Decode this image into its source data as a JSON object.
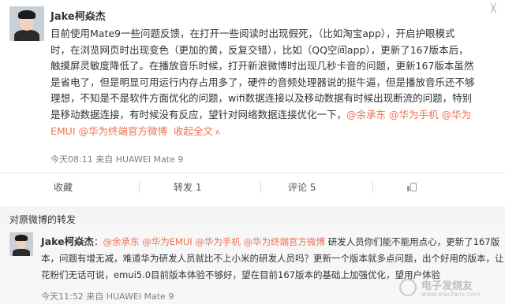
{
  "post": {
    "username": "Jake柯焱杰",
    "close_glyph": "╳",
    "lines": [
      "目前使用Mate9一些问题反馈，在打开一些阅读时出现假死，（比如淘宝app），开启护眼模式",
      "时，在浏览网页时出现变色（更加的黄，反复交错），比如（QQ空间app），更新了167版本后，",
      "触摸屏灵敏度降低了。在播放音乐时候，打开新浪微博时出现几秒卡音的问题，更新167版本虽然",
      "是省电了，但是明显可用运行内存占用多了，硬件的音频处理器说的挺牛逼，但是播放音乐还不够",
      "理想，不知是不是软件方面优化的问题，wifi数据连接以及移动数据有时候出现断流的问题，特别",
      "是移动数据连接，有时候没有反应，望针对网络数据连接优化一下，"
    ],
    "mentions_line6": "@余承东 @华为手机 @华为",
    "mentions_line7": "EMUI @华为终端官方微博",
    "expand_label": "收起全文",
    "expand_arrow": "∧",
    "meta": "今天08:11 来自 HUAWEI Mate 9",
    "actions": {
      "favorite": "收藏",
      "repost": "转发 1",
      "comment": "评论 5",
      "like": ""
    }
  },
  "repost_section": {
    "title": "对原微博的转发",
    "username": "Jake柯焱杰",
    "colon": "：",
    "mentions": "@余承东 @华为EMUI @华为手机 @华为终端官方微博",
    "line1_tail": " 研发人员你们能不能用点心，更新了167版",
    "line2": "本，问题有增无减，难道华为研发人员就比不上小米的研发人员吗？更新一个版本就多点问题，出个好用的版本，让",
    "line3": "花粉们无话可说，emui5.0目前版本体验不够好，望在目前167版本的基础上加强优化，望用户体验",
    "meta": "今天11:52 来自 HUAWEI Mate 9"
  },
  "watermark": {
    "name": "电子发烧友",
    "site": "www.elecfans.com"
  }
}
